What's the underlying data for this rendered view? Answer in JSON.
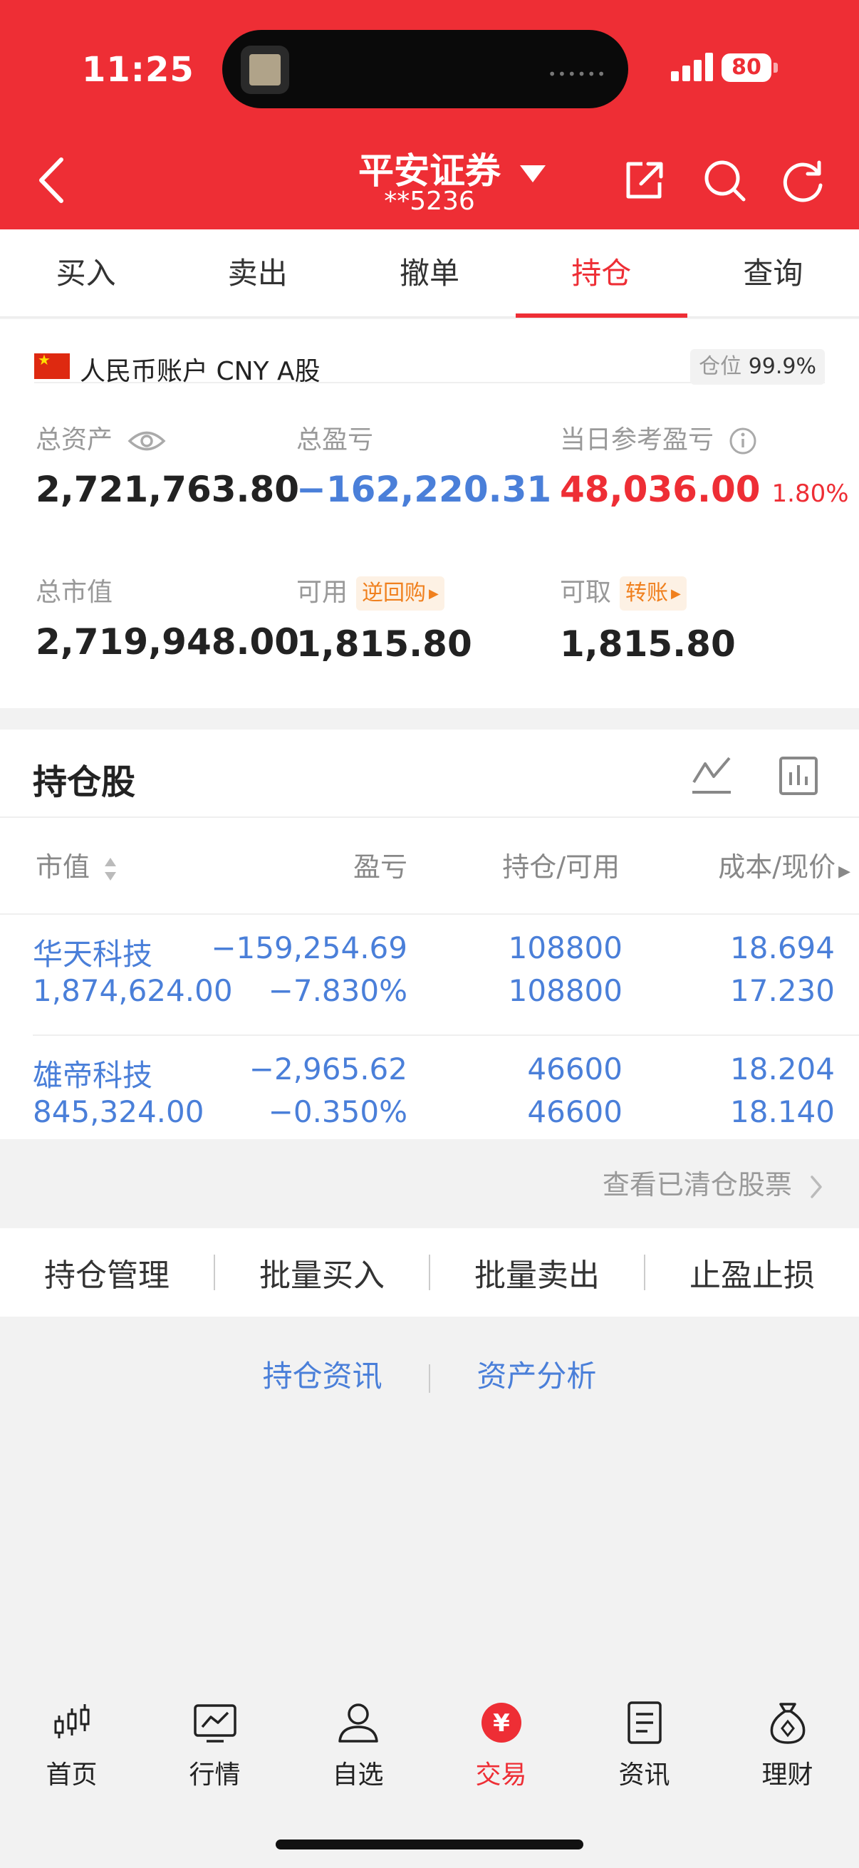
{
  "status_bar": {
    "time": "11:25",
    "battery": "80"
  },
  "header": {
    "title": "平安证券",
    "account": "**5236"
  },
  "tabs": [
    "买入",
    "卖出",
    "撤单",
    "持仓",
    "查询"
  ],
  "active_tab": "持仓",
  "account": {
    "name": "人民币账户 CNY A股",
    "position_label": "仓位",
    "position_value": "99.9%"
  },
  "stats": {
    "total_assets": {
      "label": "总资产",
      "value": "2,721,763.80"
    },
    "total_pl": {
      "label": "总盈亏",
      "value": "−162,220.31"
    },
    "daily_pl": {
      "label": "当日参考盈亏",
      "value": "48,036.00",
      "pct": "1.80%"
    },
    "market_value": {
      "label": "总市值",
      "value": "2,719,948.00"
    },
    "available": {
      "label": "可用",
      "value": "1,815.80",
      "action": "逆回购"
    },
    "withdrawable": {
      "label": "可取",
      "value": "1,815.80",
      "action": "转账"
    }
  },
  "holdings": {
    "title": "持仓股",
    "headers": [
      "市值",
      "盈亏",
      "持仓/可用",
      "成本/现价"
    ],
    "rows": [
      {
        "name": "华天科技",
        "market_value": "1,874,624.00",
        "pl": "−159,254.69",
        "pl_pct": "−7.830%",
        "position": "108800",
        "available": "108800",
        "cost": "18.694",
        "price": "17.230"
      },
      {
        "name": "雄帝科技",
        "market_value": "845,324.00",
        "pl": "−2,965.62",
        "pl_pct": "−0.350%",
        "position": "46600",
        "available": "46600",
        "cost": "18.204",
        "price": "18.140"
      }
    ]
  },
  "cleared_link": "查看已清仓股票",
  "actions": [
    "持仓管理",
    "批量买入",
    "批量卖出",
    "止盈止损"
  ],
  "links": [
    "持仓资讯",
    "资产分析"
  ],
  "bottom_nav": [
    {
      "label": "首页",
      "icon": "candlestick-icon"
    },
    {
      "label": "行情",
      "icon": "chart-line-icon"
    },
    {
      "label": "自选",
      "icon": "user-icon"
    },
    {
      "label": "交易",
      "icon": "yuan-icon"
    },
    {
      "label": "资讯",
      "icon": "document-icon"
    },
    {
      "label": "理财",
      "icon": "money-bag-icon"
    }
  ],
  "colors": {
    "brand_red": "#ee2e35",
    "link_blue": "#4a7fd9",
    "orange": "#f0801e"
  }
}
